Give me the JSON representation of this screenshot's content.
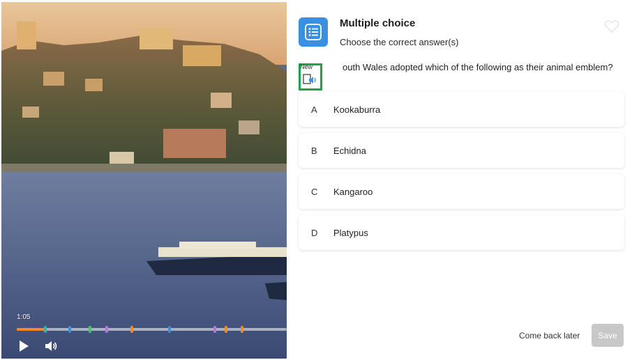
{
  "player": {
    "time": "1:05",
    "progress_fraction": 0.1,
    "chapter_marker_colors": [
      "#2bb5b0",
      "#3f8fdc",
      "#4cc36b",
      "#b27ad6",
      "#f08a24",
      "#3f8fdc",
      "#b27ad6",
      "#f08a24",
      "#f08a24"
    ],
    "play_icon": "play-icon",
    "volume_icon": "volume-icon"
  },
  "quiz": {
    "type_icon": "list-icon",
    "type_title": "Multiple choice",
    "type_subtitle": "Choose the correct answer(s)",
    "question_text": "outh Wales adopted which of the following as their animal emblem?",
    "new_badge": "New",
    "audio_icon": "text-to-speech-icon",
    "options": [
      {
        "letter": "A",
        "text": "Kookaburra"
      },
      {
        "letter": "B",
        "text": "Echidna"
      },
      {
        "letter": "C",
        "text": "Kangaroo"
      },
      {
        "letter": "D",
        "text": "Platypus"
      }
    ],
    "come_back_later_label": "Come back later",
    "save_label": "Save"
  },
  "colors": {
    "accent_blue": "#3a8fde",
    "highlight_green": "#1aa34a",
    "progress_orange": "#f08a24",
    "save_disabled": "#c8c8c8"
  }
}
